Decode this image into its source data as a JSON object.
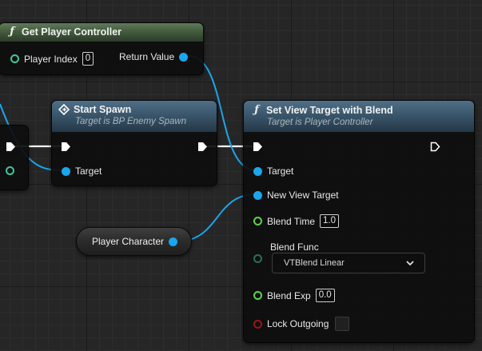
{
  "nodes": {
    "get_player_controller": {
      "title": "Get Player Controller",
      "pins": {
        "player_index_label": "Player Index",
        "player_index_value": "0",
        "return_value_label": "Return Value"
      }
    },
    "start_spawn": {
      "title": "Start Spawn",
      "subtitle": "Target is BP Enemy Spawn",
      "pins": {
        "target_label": "Target"
      }
    },
    "set_view_target": {
      "title": "Set View Target with Blend",
      "subtitle": "Target is Player Controller",
      "pins": {
        "target_label": "Target",
        "new_view_target_label": "New View Target",
        "blend_time_label": "Blend Time",
        "blend_time_value": "1.0",
        "blend_func_label": "Blend Func",
        "blend_func_value": "VTBlend Linear",
        "blend_exp_label": "Blend Exp",
        "blend_exp_value": "0.0",
        "lock_outgoing_label": "Lock Outgoing"
      }
    },
    "player_character": {
      "label": "Player Character"
    }
  },
  "colors": {
    "object_pin": "#1aa6ee",
    "float_pin": "#58d64b",
    "bool_pin": "#9a1414",
    "exec_wire": "#ffffff",
    "pure_header": "#46603f",
    "function_header": "#3a566b"
  },
  "icons": {
    "function": "function-f-icon",
    "event": "spawn-diamond-icon",
    "exec": "exec-arrow-icon",
    "dropdown": "chevron-down-icon"
  }
}
